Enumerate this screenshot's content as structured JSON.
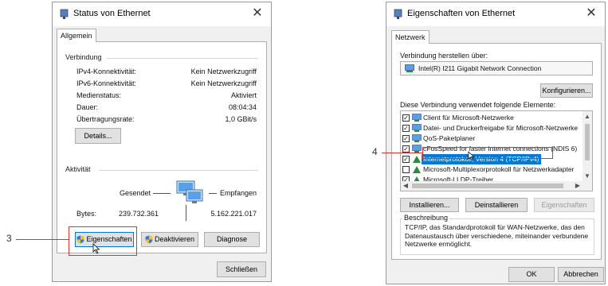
{
  "left_dialog": {
    "title": "Status von Ethernet",
    "tab": "Allgemein",
    "connection_group": "Verbindung",
    "rows": [
      {
        "label": "IPv4-Konnektivität:",
        "value": "Kein Netzwerkzugriff"
      },
      {
        "label": "IPv6-Konnektivität:",
        "value": "Kein Netzwerkzugriff"
      },
      {
        "label": "Medienstatus:",
        "value": "Aktiviert"
      },
      {
        "label": "Dauer:",
        "value": "08:04:34"
      },
      {
        "label": "Übertragungsrate:",
        "value": "1,0 GBit/s"
      }
    ],
    "details_button": "Details...",
    "activity_group": "Aktivität",
    "sent_label": "Gesendet",
    "received_label": "Empfangen",
    "bytes_label": "Bytes:",
    "bytes_sent": "239.732.361",
    "bytes_received": "5.162.221.017",
    "properties_button": "Eigenschaften",
    "deactivate_button": "Deaktivieren",
    "diagnose_button": "Diagnose",
    "close_button": "Schließen"
  },
  "right_dialog": {
    "title": "Eigenschaften von Ethernet",
    "tab": "Netzwerk",
    "connect_using_label": "Verbindung herstellen über:",
    "adapter_name": "Intel(R) I211 Gigabit Network Connection",
    "configure_button": "Konfigurieren...",
    "elements_label": "Diese Verbindung verwendet folgende Elemente:",
    "items": [
      {
        "label": "Client für Microsoft-Netzwerke",
        "checked": true
      },
      {
        "label": "Datei- und Druckerfreigabe für Microsoft-Netzwerke",
        "checked": true
      },
      {
        "label": "QoS-Paketplaner",
        "checked": true
      },
      {
        "label": "cFosSpeed for faster Internet connections (NDIS 6)",
        "checked": true
      },
      {
        "label": "Internetprotokoll, Version 4 (TCP/IPv4)",
        "checked": true
      },
      {
        "label": "Microsoft-Multiplexorprotokoll für Netzwerkadapter",
        "checked": false
      },
      {
        "label": "Microsoft-LLDP-Treiber",
        "checked": true
      }
    ],
    "install_button": "Installieren...",
    "uninstall_button": "Deinstallieren",
    "properties_button": "Eigenschaften",
    "description_group": "Beschreibung",
    "description_text": "TCP/IP, das Standardprotokoll für WAN-Netzwerke, das den Datenaustausch über verschiedene, miteinander verbundene Netzwerke ermöglicht.",
    "ok_button": "OK",
    "cancel_button": "Abbrechen"
  },
  "callouts": {
    "step3": "3",
    "step4": "4"
  },
  "colors": {
    "highlight": "#e03131",
    "selection": "#0078d7",
    "dialog_bg": "#f0f0f0"
  }
}
